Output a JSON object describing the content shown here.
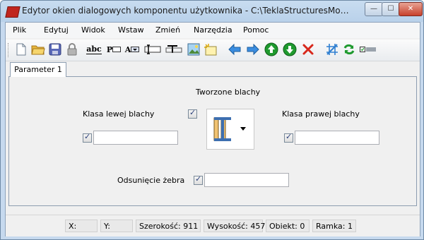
{
  "window": {
    "title": "Edytor okien dialogowych komponentu użytkownika - C:\\TeklaStructuresModels\\Stiffener...",
    "controls": {
      "minimize": "—",
      "maximize": "☐",
      "close": "✕"
    }
  },
  "menu": [
    "Plik",
    "Edytuj",
    "Widok",
    "Wstaw",
    "Zmień",
    "Narzędzia",
    "Pomoc"
  ],
  "toolbar": {
    "text_buttons": {
      "abc": "abc",
      "p": "P",
      "a": "A"
    }
  },
  "tabs": [
    "Parameter 1"
  ],
  "form": {
    "heading": "Tworzone blachy",
    "left_label": "Klasa lewej blachy",
    "right_label": "Klasa prawej blachy",
    "offset_label": "Odsunięcie żebra",
    "left_value": "",
    "right_value": "",
    "offset_value": ""
  },
  "status": {
    "x": "X:",
    "y": "Y:",
    "width": "Szerokość: 911",
    "height": "Wysokość: 457",
    "object": "Obiekt: 0",
    "frame": "Ramka: 1"
  },
  "colors": {
    "accent_blue": "#2f7fd1",
    "green": "#1f9a2f",
    "red": "#d8281c"
  }
}
